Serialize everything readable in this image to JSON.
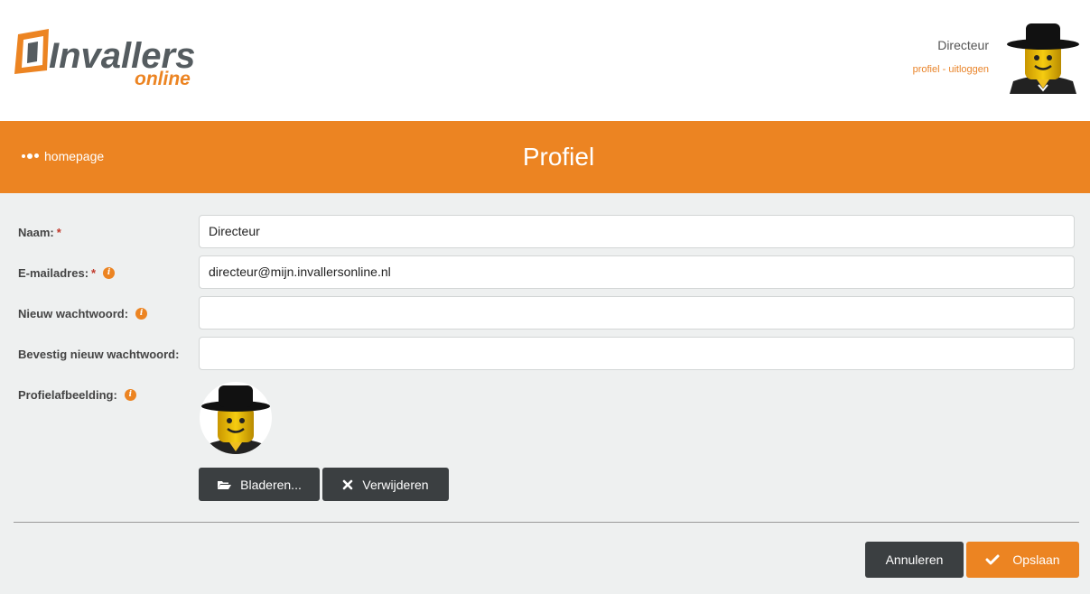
{
  "header": {
    "logo_main": "Invallers",
    "logo_sub": "online",
    "user_name": "Directeur",
    "profile_link": "profiel",
    "separator": "-",
    "logout_link": "uitloggen"
  },
  "titlebar": {
    "home_label": "homepage",
    "title": "Profiel"
  },
  "form": {
    "name_label": "Naam:",
    "name_value": "Directeur",
    "email_label": "E-mailadres:",
    "email_value": "directeur@mijn.invallersonline.nl",
    "new_password_label": "Nieuw wachtwoord:",
    "new_password_value": "",
    "confirm_password_label": "Bevestig nieuw wachtwoord:",
    "confirm_password_value": "",
    "picture_label": "Profielafbeelding:",
    "required_mark": "*",
    "browse_label": "Bladeren...",
    "remove_label": "Verwijderen"
  },
  "footer": {
    "cancel_label": "Annuleren",
    "save_label": "Opslaan"
  },
  "colors": {
    "accent": "#ec8422",
    "dark_button": "#3b3f41",
    "background": "#eef0f0"
  }
}
